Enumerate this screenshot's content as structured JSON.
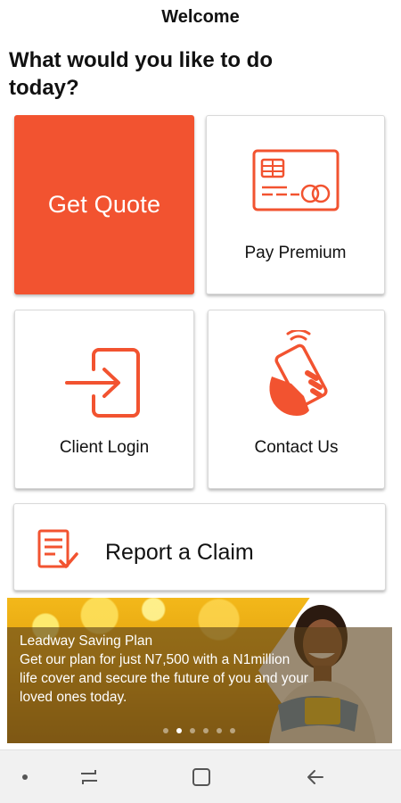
{
  "header": {
    "title": "Welcome"
  },
  "prompt": {
    "heading": "What would you like to do today?"
  },
  "tiles": [
    {
      "label": "Get Quote",
      "icon": "none"
    },
    {
      "label": "Pay Premium",
      "icon": "credit-card-icon"
    },
    {
      "label": "Client Login",
      "icon": "login-icon"
    },
    {
      "label": "Contact Us",
      "icon": "phone-hand-icon"
    }
  ],
  "claim": {
    "label": "Report a Claim",
    "icon": "claim-form-icon"
  },
  "banner": {
    "title": "Leadway Saving Plan",
    "lines": [
      "Get our plan for just N7,500 with a N1million",
      "life cover and secure the future of you and your",
      "loved ones today."
    ],
    "slides": 6,
    "active_slide": 2
  },
  "navbar": {
    "items": [
      "dot-icon",
      "recent-apps-icon",
      "home-icon",
      "back-icon"
    ]
  },
  "colors": {
    "accent": "#f25330",
    "text": "#111111",
    "navbar": "#f1f1f1"
  }
}
